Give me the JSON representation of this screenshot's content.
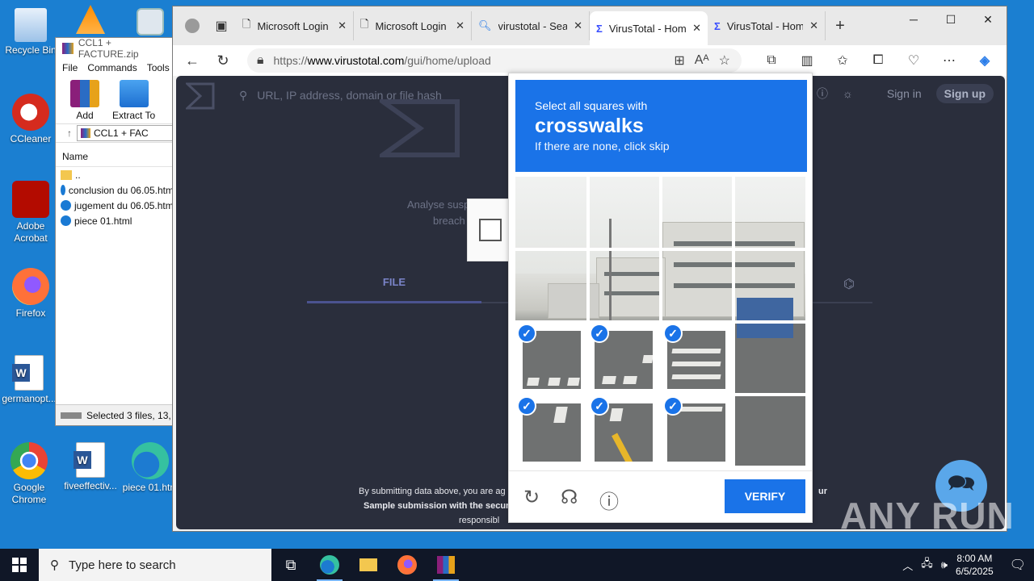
{
  "desktop": {
    "icons": [
      {
        "label": "Recycle Bin"
      },
      {
        "label": "CCleaner"
      },
      {
        "label": "Adobe Acrobat"
      },
      {
        "label": "Firefox"
      },
      {
        "label": "germanopt..."
      },
      {
        "label": "Google Chrome"
      },
      {
        "label": "fiveeffectiv..."
      },
      {
        "label": "piece 01.htm"
      }
    ]
  },
  "winrar": {
    "title": "CCL1 + FACTURE.zip",
    "menu": [
      "File",
      "Commands",
      "Tools"
    ],
    "tools": [
      "Add",
      "Extract To"
    ],
    "path": "CCL1 + FAC",
    "column": "Name",
    "files": [
      "..",
      "conclusion du 06.05.htm",
      "jugement du 06.05.htm",
      "piece 01.html"
    ],
    "status": "Selected 3 files, 13,"
  },
  "browser": {
    "tabs": [
      {
        "label": "Microsoft Login"
      },
      {
        "label": "Microsoft Login"
      },
      {
        "label": "virustotal - Search"
      },
      {
        "label": "VirusTotal - Home"
      },
      {
        "label": "VirusTotal - Home"
      }
    ],
    "url_prefix": "https://",
    "url_domain": "www.virustotal.com",
    "url_path": "/gui/home/upload"
  },
  "vt": {
    "search_placeholder": "URL, IP address, domain or file hash",
    "sign_in": "Sign in",
    "sign_up": "Sign up",
    "tagline1": "Analyse suspicious fil",
    "tagline2": "breach",
    "tab_file": "FILE",
    "terms1": "By submitting data above, you are ag",
    "terms1_end": "ur",
    "terms2": "Sample submission with the secur",
    "terms3": "responsibl"
  },
  "captcha": {
    "line1": "Select all squares with",
    "line2": "crosswalks",
    "line3": "If there are none, click skip",
    "verify": "VERIFY"
  },
  "watermark": "ANY RUN",
  "taskbar": {
    "search_placeholder": "Type here to search",
    "time": "8:00 AM",
    "date": "6/5/2025"
  }
}
